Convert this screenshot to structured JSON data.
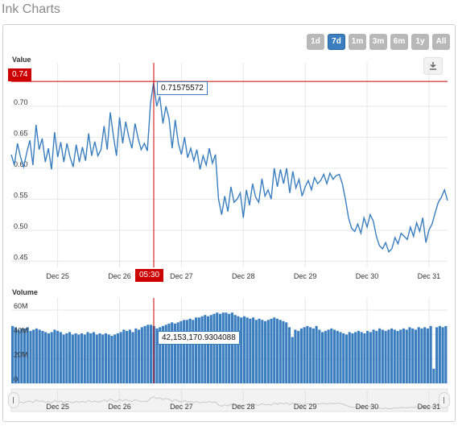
{
  "page_title": "Ink Charts",
  "range_selector": {
    "buttons": [
      "1d",
      "7d",
      "1m",
      "3m",
      "6m",
      "1y",
      "All"
    ],
    "active": "7d"
  },
  "export_icon": "download-icon",
  "colors": {
    "series": "#3a7ebf",
    "crosshair": "#cc0000",
    "axis_text": "#333333"
  },
  "chart_data": [
    {
      "type": "line",
      "title": "Value",
      "ylim": [
        0.44,
        0.77
      ],
      "y_ticks": [
        "0.45",
        "0.50",
        "0.55",
        "0.60",
        "0.65",
        "0.70"
      ],
      "x_ticks": [
        "Dec 25",
        "Dec 26",
        "Dec 27",
        "Dec 28",
        "Dec 29",
        "Dec 30",
        "Dec 31"
      ],
      "grid": true,
      "series": [
        {
          "x": [
            24.25,
            24.3,
            24.35,
            24.4,
            24.45,
            24.5,
            24.55,
            24.6,
            24.65,
            24.7,
            24.75,
            24.8,
            24.85,
            24.9,
            24.95,
            25.0,
            25.05,
            25.1,
            25.15,
            25.2,
            25.25,
            25.3,
            25.35,
            25.4,
            25.45,
            25.5,
            25.55,
            25.6,
            25.65,
            25.7,
            25.75,
            25.8,
            25.85,
            25.9,
            25.95,
            26.0,
            26.05,
            26.1,
            26.15,
            26.2,
            26.25,
            26.3,
            26.35,
            26.4,
            26.45,
            26.5,
            26.55,
            26.6,
            26.65,
            26.7,
            26.75,
            26.8,
            26.85,
            26.9,
            26.95,
            27.0,
            27.05,
            27.1,
            27.15,
            27.2,
            27.25,
            27.3,
            27.35,
            27.4,
            27.45,
            27.5,
            27.55,
            27.6,
            27.65,
            27.7,
            27.75,
            27.8,
            27.85,
            27.9,
            27.95,
            28.0,
            28.05,
            28.1,
            28.15,
            28.2,
            28.25,
            28.3,
            28.35,
            28.4,
            28.45,
            28.5,
            28.55,
            28.6,
            28.65,
            28.7,
            28.75,
            28.8,
            28.85,
            28.9,
            28.95,
            29.0,
            29.05,
            29.1,
            29.15,
            29.2,
            29.25,
            29.3,
            29.35,
            29.4,
            29.45,
            29.5,
            29.55,
            29.6,
            29.65,
            29.7,
            29.75,
            29.8,
            29.85,
            29.9,
            29.95,
            30.0,
            30.05,
            30.1,
            30.15,
            30.2,
            30.25,
            30.3,
            30.35,
            30.4,
            30.45,
            30.5,
            30.55,
            30.6,
            30.65,
            30.7,
            30.75,
            30.8,
            30.85,
            30.9,
            30.95,
            31.0,
            31.05,
            31.1,
            31.15,
            31.2,
            31.25,
            31.3
          ],
          "values": [
            0.622,
            0.605,
            0.64,
            0.618,
            0.602,
            0.625,
            0.645,
            0.605,
            0.67,
            0.63,
            0.648,
            0.61,
            0.632,
            0.598,
            0.658,
            0.618,
            0.642,
            0.61,
            0.64,
            0.618,
            0.602,
            0.638,
            0.61,
            0.634,
            0.612,
            0.656,
            0.62,
            0.643,
            0.62,
            0.63,
            0.668,
            0.63,
            0.69,
            0.652,
            0.62,
            0.682,
            0.64,
            0.675,
            0.65,
            0.632,
            0.672,
            0.648,
            0.63,
            0.64,
            0.628,
            0.705,
            0.738,
            0.7,
            0.716,
            0.672,
            0.7,
            0.68,
            0.632,
            0.678,
            0.64,
            0.622,
            0.65,
            0.617,
            0.632,
            0.612,
            0.63,
            0.598,
            0.62,
            0.605,
            0.632,
            0.608,
            0.622,
            0.55,
            0.525,
            0.555,
            0.53,
            0.57,
            0.545,
            0.55,
            0.56,
            0.52,
            0.565,
            0.54,
            0.575,
            0.553,
            0.545,
            0.583,
            0.555,
            0.565,
            0.55,
            0.6,
            0.57,
            0.598,
            0.575,
            0.6,
            0.56,
            0.595,
            0.568,
            0.582,
            0.555,
            0.57,
            0.58,
            0.565,
            0.585,
            0.575,
            0.58,
            0.59,
            0.575,
            0.592,
            0.582,
            0.588,
            0.59,
            0.575,
            0.55,
            0.52,
            0.503,
            0.498,
            0.51,
            0.495,
            0.52,
            0.505,
            0.525,
            0.515,
            0.49,
            0.475,
            0.47,
            0.48,
            0.465,
            0.47,
            0.488,
            0.478,
            0.495,
            0.49,
            0.485,
            0.505,
            0.49,
            0.512,
            0.498,
            0.52,
            0.48,
            0.5,
            0.51,
            0.528,
            0.545,
            0.553,
            0.565,
            0.548
          ]
        }
      ],
      "crosshair": {
        "y_badge": "0.74",
        "x_badge": "05:30",
        "tooltip": "0.71575572"
      }
    },
    {
      "type": "bar",
      "title": "Volume",
      "ylim": [
        0,
        70
      ],
      "y_ticks": [
        "0",
        "20M",
        "40M",
        "60M"
      ],
      "x_ticks": [
        "Dec 25",
        "Dec 26",
        "Dec 27",
        "Dec 28",
        "Dec 29",
        "Dec 30",
        "Dec 31"
      ],
      "grid": true,
      "values_million": [
        47,
        46,
        44,
        45,
        45,
        46,
        43,
        44,
        45,
        44,
        43,
        42,
        41,
        42,
        44,
        43,
        42,
        40,
        41,
        42,
        40,
        41,
        40,
        41,
        40,
        42,
        41,
        42,
        40,
        41,
        40,
        41,
        40,
        39,
        40,
        41,
        42,
        44,
        43,
        44,
        42,
        45,
        44,
        46,
        47,
        48,
        48,
        47,
        45,
        46,
        47,
        48,
        49,
        50,
        49,
        50,
        51,
        52,
        52,
        53,
        52,
        54,
        54,
        55,
        56,
        55,
        56,
        57,
        58,
        57,
        58,
        58,
        57,
        58,
        56,
        55,
        54,
        55,
        54,
        53,
        54,
        52,
        53,
        52,
        51,
        52,
        53,
        54,
        53,
        52,
        51,
        50,
        46,
        38,
        44,
        43,
        45,
        46,
        47,
        46,
        45,
        47,
        44,
        42,
        43,
        44,
        45,
        44,
        43,
        42,
        41,
        40,
        42,
        41,
        42,
        43,
        42,
        41,
        43,
        42,
        44,
        43,
        45,
        44,
        43,
        44,
        45,
        44,
        43,
        44,
        45,
        44,
        46,
        45,
        44,
        46,
        45,
        46,
        45,
        47,
        12,
        46,
        47,
        46,
        47
      ]
    },
    {
      "type": "area",
      "title": "",
      "x_ticks": [
        "Dec 25",
        "Dec 26",
        "Dec 27",
        "Dec 28",
        "Dec 29",
        "Dec 30",
        "Dec 31"
      ]
    }
  ],
  "volume_tooltip": "42,153,170.9304088"
}
